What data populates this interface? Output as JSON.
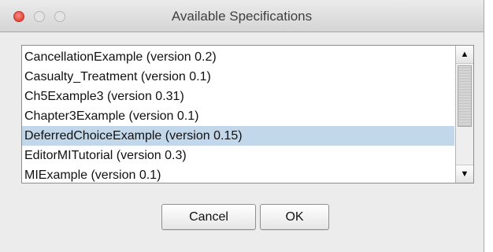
{
  "window": {
    "title": "Available Specifications",
    "controls": [
      "close-icon",
      "minimize-icon",
      "zoom-icon"
    ]
  },
  "list": {
    "items": [
      "CancellationExample (version 0.2)",
      "Casualty_Treatment (version 0.1)",
      "Ch5Example3 (version 0.31)",
      "Chapter3Example (version 0.1)",
      "DeferredChoiceExample (version 0.15)",
      "EditorMITutorial (version 0.3)",
      "MIExample (version 0.1)"
    ],
    "selected_index": 4,
    "selection_color": "#c3d7ea"
  },
  "scrollbar": {
    "up_arrow": "▲",
    "down_arrow": "▼"
  },
  "buttons": {
    "cancel": "Cancel",
    "ok": "OK"
  }
}
